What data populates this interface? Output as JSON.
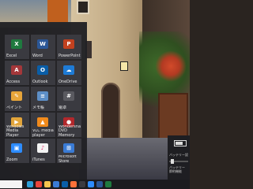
{
  "tiles": [
    {
      "label": "Excel",
      "icon": "excel-icon",
      "color": "#1f7a3f",
      "glyph": "X"
    },
    {
      "label": "Word",
      "icon": "word-icon",
      "color": "#2b5797",
      "glyph": "W"
    },
    {
      "label": "PowerPoint",
      "icon": "powerpoint-icon",
      "color": "#c2411f",
      "glyph": "P"
    },
    {
      "label": "Access",
      "icon": "access-icon",
      "color": "#a4373a",
      "glyph": "A"
    },
    {
      "label": "Outlook",
      "icon": "outlook-icon",
      "color": "#0a5ea8",
      "glyph": "O"
    },
    {
      "label": "OneDrive",
      "icon": "onedrive-icon",
      "color": "#1e7bd6",
      "glyph": "☁"
    },
    {
      "label": "ペイント",
      "icon": "paint-icon",
      "color": "#e7a53a",
      "glyph": "✎"
    },
    {
      "label": "メモ帳",
      "icon": "notepad-icon",
      "color": "#5d8fc7",
      "glyph": "≡"
    },
    {
      "label": "電卓",
      "icon": "calculator-icon",
      "color": "#5a5a60",
      "glyph": "#"
    },
    {
      "label": "Windows Media Player",
      "icon": "media-player-icon",
      "color": "#e2a43a",
      "glyph": "▶"
    },
    {
      "label": "VLC media player",
      "icon": "vlc-icon",
      "color": "#f08a1c",
      "glyph": "▲"
    },
    {
      "label": "Wondershare DVD Memory",
      "icon": "dvd-memory-icon",
      "color": "#b2282c",
      "glyph": "●"
    },
    {
      "label": "Zoom",
      "icon": "zoom-icon",
      "color": "#2d8cff",
      "glyph": "▣"
    },
    {
      "label": "iTunes",
      "icon": "itunes-icon",
      "color": "#f4f4f4",
      "glyph": "♪"
    },
    {
      "label": "Microsoft Store",
      "icon": "store-icon",
      "color": "#3a7bd5",
      "glyph": "⊞"
    }
  ],
  "battery": {
    "settings_label": "バッテリー設定",
    "status_text": "バッテリー 節約機能"
  },
  "taskbar": {
    "icons": [
      {
        "name": "edge-icon",
        "color": "#2e9fd8"
      },
      {
        "name": "chrome-icon",
        "color": "#e8453c"
      },
      {
        "name": "file-explorer-icon",
        "color": "#f4c44e"
      },
      {
        "name": "store-taskbar-icon",
        "color": "#3a7bd5"
      },
      {
        "name": "mail-icon",
        "color": "#0a5ea8"
      },
      {
        "name": "firefox-icon",
        "color": "#ff7139"
      },
      {
        "name": "terminal-icon",
        "color": "#3a3a40"
      },
      {
        "name": "photos-icon",
        "color": "#2d8cff"
      },
      {
        "name": "word-taskbar-icon",
        "color": "#2b5797"
      },
      {
        "name": "excel-taskbar-icon",
        "color": "#1f7a3f"
      }
    ]
  }
}
